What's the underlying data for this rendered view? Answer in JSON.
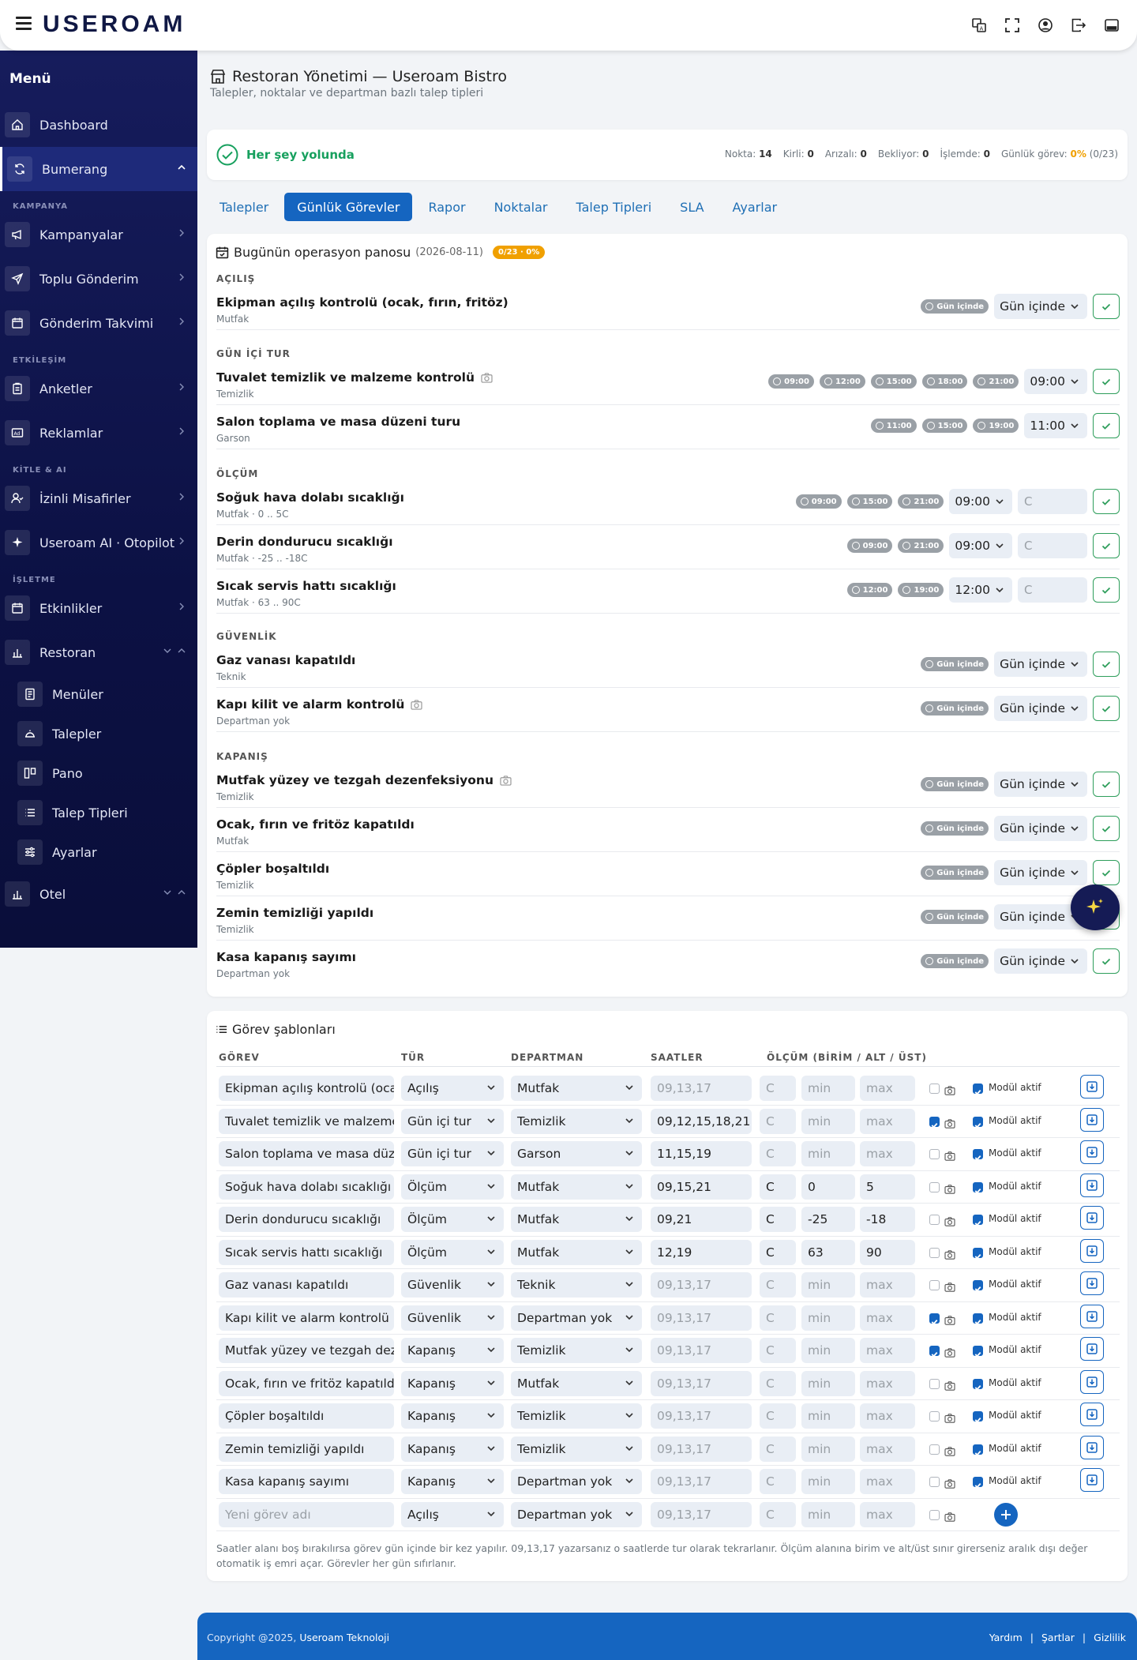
{
  "topbar": {
    "logo": "USEROAM"
  },
  "sidebar": {
    "title": "Menü",
    "sections": {
      "campaign": "KAMPANYA",
      "engagement": "ETKİLEŞİM",
      "audience": "KİTLE & AI",
      "business": "İŞLETME"
    },
    "items": {
      "dashboard": "Dashboard",
      "bumerang": "Bumerang",
      "kampanyalar": "Kampanyalar",
      "toplu": "Toplu Gönderim",
      "takvim": "Gönderim Takvimi",
      "anketler": "Anketler",
      "reklamlar": "Reklamlar",
      "misafirler": "İzinli Misafirler",
      "ai": "Useroam AI · Otopilot",
      "etkinlikler": "Etkinlikler",
      "restoran": "Restoran",
      "menuler": "Menüler",
      "talepler": "Talepler",
      "pano": "Pano",
      "talep_tipleri": "Talep Tipleri",
      "ayarlar": "Ayarlar",
      "otel": "Otel"
    }
  },
  "page": {
    "title": "Restoran Yönetimi — Useroam Bistro",
    "subtitle": "Talepler, noktalar ve departman bazlı talep tipleri"
  },
  "status": {
    "label": "Her şey yolunda",
    "nokta_label": "Nokta:",
    "nokta": "14",
    "kirli_label": "Kirli:",
    "kirli": "0",
    "arizali_label": "Arızalı:",
    "arizali": "0",
    "bekliyor_label": "Bekliyor:",
    "bekliyor": "0",
    "islemde_label": "İşlemde:",
    "islemde": "0",
    "gunluk_label": "Günlük görev:",
    "gunluk_pct": "0%",
    "gunluk_count": "(0/23)"
  },
  "tabs": [
    "Talepler",
    "Günlük Görevler",
    "Rapor",
    "Noktalar",
    "Talep Tipleri",
    "SLA",
    "Ayarlar"
  ],
  "ops": {
    "title": "Bugünün operasyon panosu",
    "date": "(2026-08-11)",
    "badge": "0/23 · 0%",
    "groups": [
      "AÇILIŞ",
      "GÜN İÇİ TUR",
      "ÖLÇÜM",
      "GÜVENLİK",
      "KAPANIŞ"
    ],
    "tasks": [
      {
        "name": "Ekipman açılış kontrolü (ocak, fırın, fritöz)",
        "dept": "Mutfak",
        "pills": [
          "Gün içinde"
        ],
        "select": "Gün içinde"
      },
      {
        "name": "Tuvalet temizlik ve malzeme kontrolü",
        "dept": "Temizlik",
        "pills": [
          "09:00",
          "12:00",
          "15:00",
          "18:00",
          "21:00"
        ],
        "select": "09:00"
      },
      {
        "name": "Salon toplama ve masa düzeni turu",
        "dept": "Garson",
        "pills": [
          "11:00",
          "15:00",
          "19:00"
        ],
        "select": "11:00"
      },
      {
        "name": "Soğuk hava dolabı sıcaklığı",
        "dept": "Mutfak · 0 .. 5C",
        "pills": [
          "09:00",
          "15:00",
          "21:00"
        ],
        "select": "09:00",
        "input": "C"
      },
      {
        "name": "Derin dondurucu sıcaklığı",
        "dept": "Mutfak · -25 .. -18C",
        "pills": [
          "09:00",
          "21:00"
        ],
        "select": "09:00",
        "input": "C"
      },
      {
        "name": "Sıcak servis hattı sıcaklığı",
        "dept": "Mutfak · 63 .. 90C",
        "pills": [
          "12:00",
          "19:00"
        ],
        "select": "12:00",
        "input": "C"
      },
      {
        "name": "Gaz vanası kapatıldı",
        "dept": "Teknik",
        "pills": [
          "Gün içinde"
        ],
        "select": "Gün içinde"
      },
      {
        "name": "Kapı kilit ve alarm kontrolü",
        "dept": "Departman yok",
        "pills": [
          "Gün içinde"
        ],
        "select": "Gün içinde"
      },
      {
        "name": "Mutfak yüzey ve tezgah dezenfeksiyonu",
        "dept": "Temizlik",
        "pills": [
          "Gün içinde"
        ],
        "select": "Gün içinde"
      },
      {
        "name": "Ocak, fırın ve fritöz kapatıldı",
        "dept": "Mutfak",
        "pills": [
          "Gün içinde"
        ],
        "select": "Gün içinde"
      },
      {
        "name": "Çöpler boşaltıldı",
        "dept": "Temizlik",
        "pills": [
          "Gün içinde"
        ],
        "select": "Gün içinde"
      },
      {
        "name": "Zemin temizliği yapıldı",
        "dept": "Temizlik",
        "pills": [
          "Gün içinde"
        ],
        "select": "Gün içinde"
      },
      {
        "name": "Kasa kapanış sayımı",
        "dept": "Departman yok",
        "pills": [
          "Gün içinde"
        ],
        "select": "Gün içinde"
      }
    ]
  },
  "templates": {
    "title": "Görev şablonları",
    "headers": [
      "GÖREV",
      "TÜR",
      "DEPARTMAN",
      "SAATLER",
      "ÖLÇÜM (BİRİM / ALT / ÜST)"
    ],
    "module_label": "Modül aktif",
    "placeholders": {
      "name": "Yeni görev adı",
      "hours": "09,13,17",
      "unit": "C",
      "min": "min",
      "max": "max"
    },
    "rows": [
      {
        "name": "Ekipman açılış kontrolü (ocak,",
        "type": "Açılış",
        "dept": "Mutfak",
        "hours": "",
        "unit": "",
        "min": "",
        "max": "",
        "photo": false
      },
      {
        "name": "Tuvalet temizlik ve malzeme",
        "type": "Gün içi tur",
        "dept": "Temizlik",
        "hours": "09,12,15,18,21",
        "unit": "",
        "min": "",
        "max": "",
        "photo": true
      },
      {
        "name": "Salon toplama ve masa düz",
        "type": "Gün içi tur",
        "dept": "Garson",
        "hours": "11,15,19",
        "unit": "",
        "min": "",
        "max": "",
        "photo": false
      },
      {
        "name": "Soğuk hava dolabı sıcaklığı",
        "type": "Ölçüm",
        "dept": "Mutfak",
        "hours": "09,15,21",
        "unit": "C",
        "min": "0",
        "max": "5",
        "photo": false
      },
      {
        "name": "Derin dondurucu sıcaklığı",
        "type": "Ölçüm",
        "dept": "Mutfak",
        "hours": "09,21",
        "unit": "C",
        "min": "-25",
        "max": "-18",
        "photo": false
      },
      {
        "name": "Sıcak servis hattı sıcaklığı",
        "type": "Ölçüm",
        "dept": "Mutfak",
        "hours": "12,19",
        "unit": "C",
        "min": "63",
        "max": "90",
        "photo": false
      },
      {
        "name": "Gaz vanası kapatıldı",
        "type": "Güvenlik",
        "dept": "Teknik",
        "hours": "",
        "unit": "",
        "min": "",
        "max": "",
        "photo": false
      },
      {
        "name": "Kapı kilit ve alarm kontrolü",
        "type": "Güvenlik",
        "dept": "Departman yok",
        "hours": "",
        "unit": "",
        "min": "",
        "max": "",
        "photo": true
      },
      {
        "name": "Mutfak yüzey ve tezgah dez",
        "type": "Kapanış",
        "dept": "Temizlik",
        "hours": "",
        "unit": "",
        "min": "",
        "max": "",
        "photo": true
      },
      {
        "name": "Ocak, fırın ve fritöz kapatıld",
        "type": "Kapanış",
        "dept": "Mutfak",
        "hours": "",
        "unit": "",
        "min": "",
        "max": "",
        "photo": false
      },
      {
        "name": "Çöpler boşaltıldı",
        "type": "Kapanış",
        "dept": "Temizlik",
        "hours": "",
        "unit": "",
        "min": "",
        "max": "",
        "photo": false
      },
      {
        "name": "Zemin temizliği yapıldı",
        "type": "Kapanış",
        "dept": "Temizlik",
        "hours": "",
        "unit": "",
        "min": "",
        "max": "",
        "photo": false
      },
      {
        "name": "Kasa kapanış sayımı",
        "type": "Kapanış",
        "dept": "Departman yok",
        "hours": "",
        "unit": "",
        "min": "",
        "max": "",
        "photo": false
      }
    ],
    "new_row": {
      "type": "Açılış",
      "dept": "Departman yok"
    },
    "note": "Saatler alanı boş bırakılırsa görev gün içinde bir kez yapılır. 09,13,17 yazarsanız o saatlerde tur olarak tekrarlanır. Ölçüm alanına birim ve alt/üst sınır girerseniz aralık dışı değer otomatik iş emri açar. Görevler her gün sıfırlanır."
  },
  "footer": {
    "copyright": "Copyright @2025,",
    "company": "Useroam Teknoloji",
    "links": [
      "Yardım",
      "Şartlar",
      "Gizlilik"
    ]
  }
}
